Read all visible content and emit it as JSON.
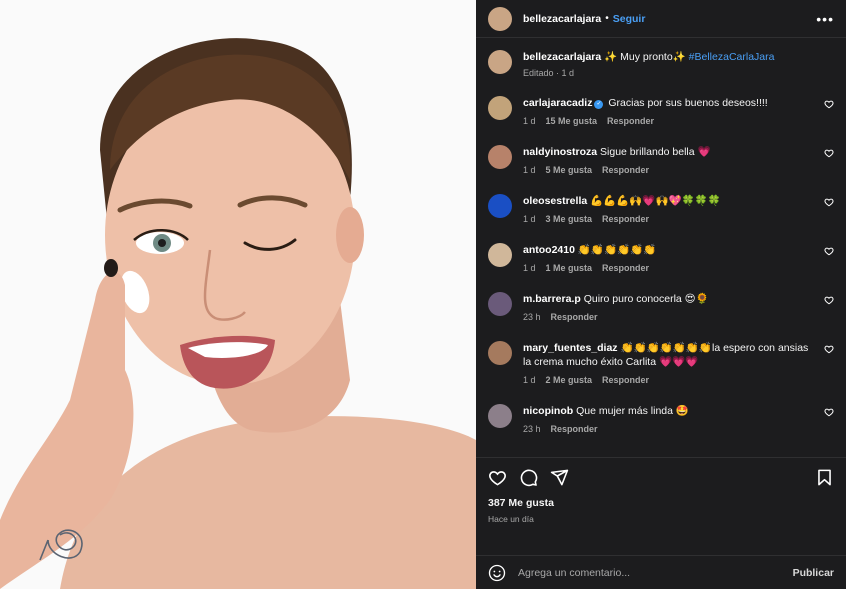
{
  "post": {
    "author": "bellezacarlajara",
    "follow_label": "Seguir",
    "dot": "•",
    "more": "•••"
  },
  "caption": {
    "user": "bellezacarlajara",
    "text": " ✨ Muy pronto✨ ",
    "hashtag": "#BellezaCarlaJara",
    "meta": "Editado · 1 d"
  },
  "comments": [
    {
      "user": "carlajaracadiz",
      "verified": true,
      "text": " Gracias por sus buenos deseos!!!!",
      "time": "1 d",
      "likes": "15 Me gusta",
      "reply": "Responder",
      "avatar": "#c2a37a"
    },
    {
      "user": "naldyinostroza",
      "verified": false,
      "text": " Sigue brillando bella 💗",
      "time": "1 d",
      "likes": "5 Me gusta",
      "reply": "Responder",
      "avatar": "#b7826a"
    },
    {
      "user": "oleosestrella",
      "verified": false,
      "text": " 💪💪💪🙌💗🙌💖🍀🍀🍀",
      "time": "1 d",
      "likes": "3 Me gusta",
      "reply": "Responder",
      "avatar": "#1a4fc4"
    },
    {
      "user": "antoo2410",
      "verified": false,
      "text": " 👏👏👏👏👏👏",
      "time": "1 d",
      "likes": "1 Me gusta",
      "reply": "Responder",
      "avatar": "#d0b79a"
    },
    {
      "user": "m.barrera.p",
      "verified": false,
      "text": " Quiro puro conocerla 😍🌻",
      "time": "23 h",
      "likes": "",
      "reply": "Responder",
      "avatar": "#6a5a7a"
    },
    {
      "user": "mary_fuentes_diaz",
      "verified": false,
      "text": " 👏👏👏👏👏👏👏la espero con ansias la crema mucho éxito Carlita 💗💗💗",
      "time": "1 d",
      "likes": "2 Me gusta",
      "reply": "Responder",
      "avatar": "#a57a5e"
    },
    {
      "user": "nicopinob",
      "verified": false,
      "text": " Que mujer más linda 🤩",
      "time": "23 h",
      "likes": "",
      "reply": "Responder",
      "avatar": "#8c7f8a"
    }
  ],
  "footer": {
    "likes": "387 Me gusta",
    "time_ago": "Hace un día",
    "comment_placeholder": "Agrega un comentario...",
    "post_label": "Publicar"
  },
  "colors": {
    "panel_bg": "#1c1c1e",
    "link": "#4a9ff5",
    "muted": "#a8a8a8"
  }
}
